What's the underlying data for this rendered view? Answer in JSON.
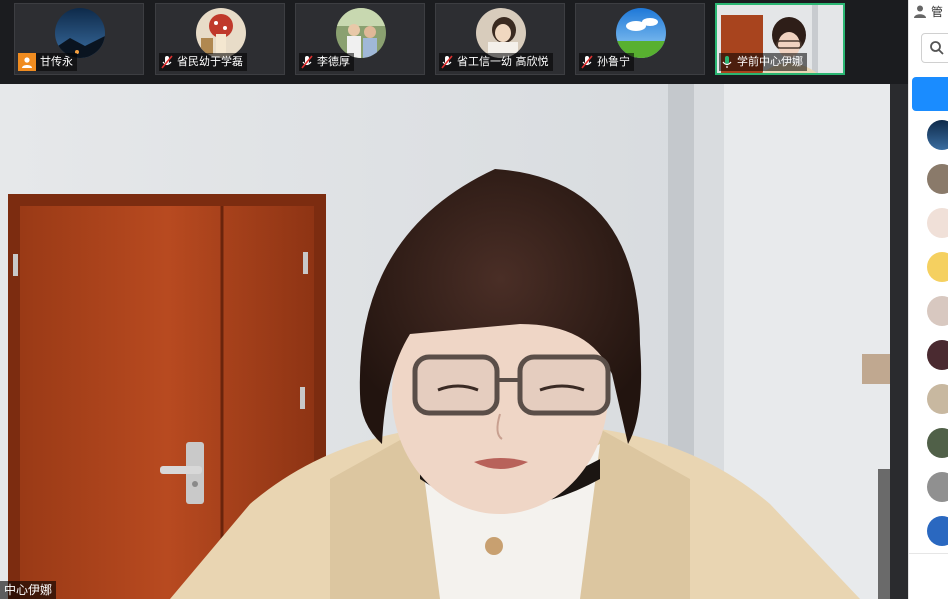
{
  "participants": [
    {
      "name": "甘传永",
      "badge": "user-badge"
    },
    {
      "name": "省民幼于学磊",
      "mic": "muted"
    },
    {
      "name": "李德厚",
      "mic": "muted"
    },
    {
      "name": "省工信一幼 高欣悦",
      "mic": "muted"
    },
    {
      "name": "孙鲁宁",
      "mic": "muted"
    },
    {
      "name": "学前中心伊娜",
      "mic": "active"
    }
  ],
  "main_video": {
    "speaker_label": "中心伊娜"
  },
  "side_panel": {
    "header": "管"
  },
  "colors": {
    "active_border": "#2bb673",
    "accent_blue": "#1a8cff",
    "muted_mic": "#e03030",
    "badge_orange": "#f08c20"
  }
}
